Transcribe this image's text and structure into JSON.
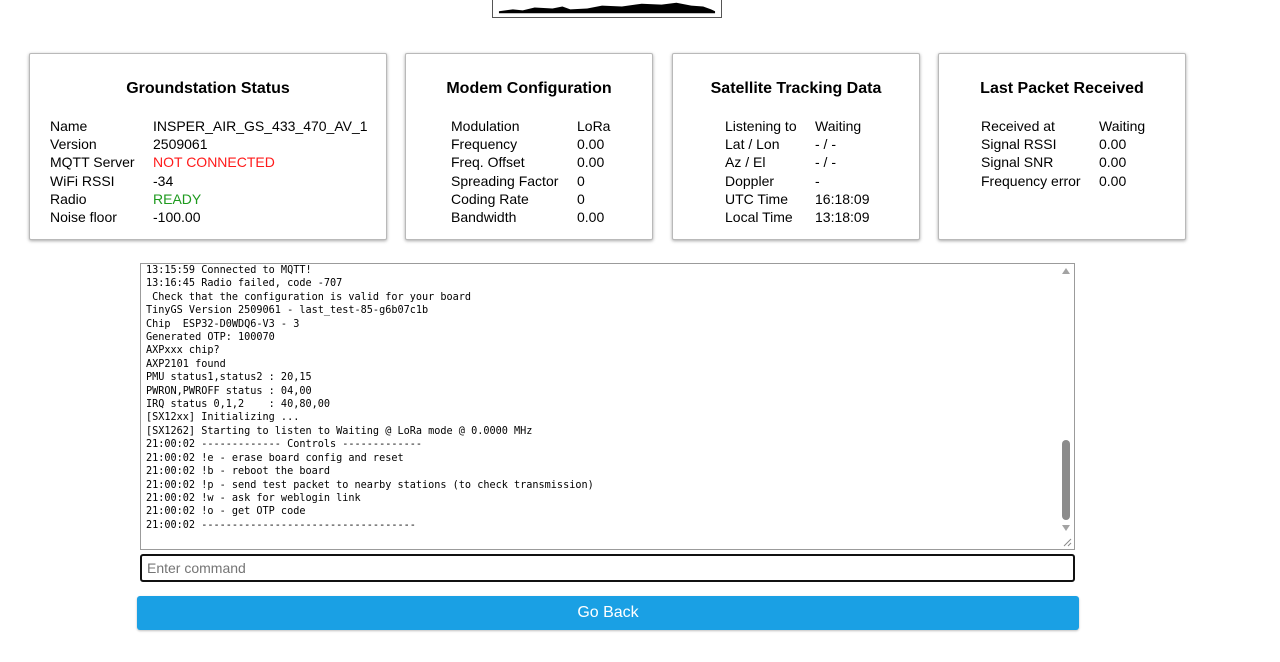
{
  "cards": {
    "groundstation": {
      "title": "Groundstation Status",
      "rows": [
        {
          "label": "Name",
          "value": "INSPER_AIR_GS_433_470_AV_1"
        },
        {
          "label": "Version",
          "value": "2509061"
        },
        {
          "label": "MQTT Server",
          "value": "NOT CONNECTED"
        },
        {
          "label": "WiFi RSSI",
          "value": "-34"
        },
        {
          "label": "Radio",
          "value": "READY"
        },
        {
          "label": "Noise floor",
          "value": "-100.00"
        }
      ]
    },
    "modem": {
      "title": "Modem Configuration",
      "rows": [
        {
          "label": "Modulation",
          "value": "LoRa"
        },
        {
          "label": "Frequency",
          "value": "0.00"
        },
        {
          "label": "Freq. Offset",
          "value": "0.00"
        },
        {
          "label": "Spreading Factor",
          "value": "0"
        },
        {
          "label": "Coding Rate",
          "value": "0"
        },
        {
          "label": "Bandwidth",
          "value": "0.00"
        }
      ]
    },
    "satellite": {
      "title": "Satellite Tracking Data",
      "rows": [
        {
          "label": "Listening to",
          "value": "Waiting"
        },
        {
          "label": "Lat / Lon",
          "value": "- / -"
        },
        {
          "label": "Az / El",
          "value": "- / -"
        },
        {
          "label": "Doppler",
          "value": "-"
        },
        {
          "label": "UTC Time",
          "value": "16:18:09"
        },
        {
          "label": "Local Time",
          "value": "13:18:09"
        }
      ]
    },
    "packet": {
      "title": "Last Packet Received",
      "rows": [
        {
          "label": "Received at",
          "value": "Waiting"
        },
        {
          "label": "Signal RSSI",
          "value": "0.00"
        },
        {
          "label": "Signal SNR",
          "value": "0.00"
        },
        {
          "label": "Frequency error",
          "value": "0.00"
        }
      ]
    }
  },
  "colors": {
    "not_connected": "#ff1a1a",
    "ready": "#1e9a1e",
    "button": "#1aa0e4"
  },
  "console": {
    "lines": [
      "13:15:59 Connected to MQTT!",
      "13:16:45 Radio failed, code -707",
      " Check that the configuration is valid for your board",
      "TinyGS Version 2509061 - last_test-85-g6b07c1b",
      "Chip  ESP32-D0WDQ6-V3 - 3",
      "Generated OTP: 100070",
      "AXPxxx chip?",
      "AXP2101 found",
      "PMU status1,status2 : 20,15",
      "PWRON,PWROFF status : 04,00",
      "IRQ status 0,1,2    : 40,80,00",
      "[SX12xx] Initializing ...",
      "[SX1262] Starting to listen to Waiting @ LoRa mode @ 0.0000 MHz",
      "21:00:02 ------------- Controls -------------",
      "21:00:02 !e - erase board config and reset",
      "21:00:02 !b - reboot the board",
      "21:00:02 !p - send test packet to nearby stations (to check transmission)",
      "21:00:02 !w - ask for weblogin link",
      "21:00:02 !o - get OTP code",
      "21:00:02 -----------------------------------"
    ]
  },
  "command": {
    "placeholder": "Enter command",
    "value": ""
  },
  "back_button": {
    "label": "Go Back"
  }
}
